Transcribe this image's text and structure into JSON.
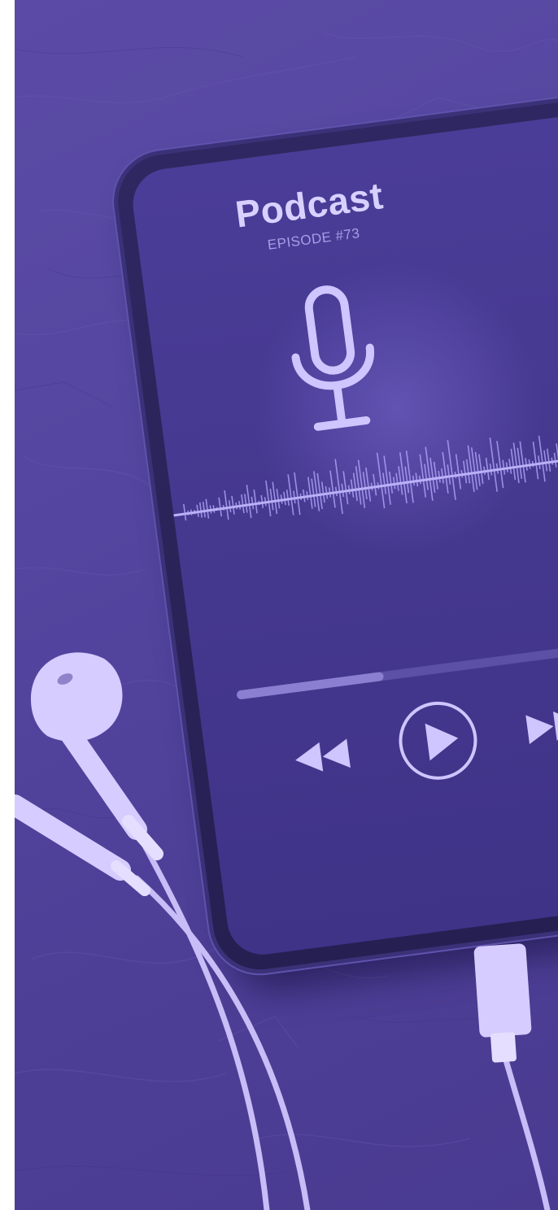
{
  "screen": {
    "title": "Podcast",
    "episode": "EPISODE #73"
  },
  "player": {
    "progress": 0.35,
    "controls": {
      "rewind": "rewind-icon",
      "play": "play-icon",
      "forward": "fast-forward-icon"
    }
  },
  "icons": {
    "microphone": "microphone-icon",
    "waveform": "audio-waveform"
  },
  "colors": {
    "tint": "#5446a0",
    "screen": "#45388f",
    "accent": "#c9bfff",
    "text": "#d8d0ff"
  }
}
